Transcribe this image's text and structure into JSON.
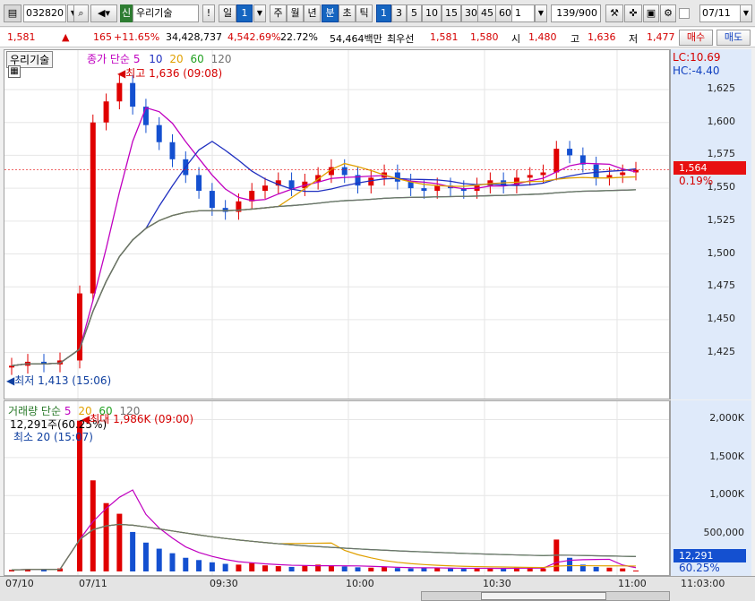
{
  "toolbar": {
    "code": "032820",
    "market_badge": "신",
    "stock_name": "우리기술",
    "alert": "!",
    "period_day": "일",
    "period_day_count": "1",
    "periods": [
      "주",
      "월",
      "년"
    ],
    "minute": "분",
    "second": "초",
    "tick": "틱",
    "intervals": [
      "1",
      "3",
      "5",
      "10",
      "15",
      "30",
      "45",
      "60"
    ],
    "interval_count": "1",
    "data_count": "139/900",
    "date": "07/11"
  },
  "quote": {
    "price": "1,581",
    "change_arrow": "▲",
    "change": "165",
    "change_pct": "+11.65%",
    "volume": "34,428,737",
    "volume_ratio": "4,542.69%",
    "turnover": "22.72%",
    "amount": "54,464백만",
    "best_label": "최우선",
    "ask": "1,581",
    "bid": "1,580",
    "open_label": "시",
    "open": "1,480",
    "high_label": "고",
    "high": "1,636",
    "low_label": "저",
    "low": "1,477",
    "buy_button": "매수",
    "sell_button": "매도"
  },
  "price_panel": {
    "name": "우리기술",
    "legend_label": "종가 단순",
    "ma": [
      "5",
      "10",
      "20",
      "60",
      "120"
    ],
    "ma_colors": [
      "#c000c0",
      "#2030c0",
      "#e0a000",
      "#20a020",
      "#707070"
    ],
    "high_annotation": "최고 1,636 (09:08)",
    "low_annotation": "최저 1,413 (15:06)",
    "lc": "LC:10.69",
    "hc": "HC:-4.40",
    "current_price": "1,564",
    "current_pct": "0.19%",
    "y_ticks": [
      "1,625",
      "1,600",
      "1,575",
      "1,550",
      "1,525",
      "1,500",
      "1,475",
      "1,450",
      "1,425"
    ]
  },
  "volume_panel": {
    "legend_label": "거래량 단순",
    "ma": [
      "5",
      "20",
      "60",
      "120"
    ],
    "ma_colors": [
      "#c000c0",
      "#e0a000",
      "#20a020",
      "#707070"
    ],
    "current_line": "12,291주(60.25%)",
    "max_annotation": "최대 1,986K (09:00)",
    "min_annotation": "최소 20 (15:07)",
    "current_value": "12,291",
    "current_pct": "60.25%",
    "y_ticks": [
      "2,000K",
      "1,500K",
      "1,000K",
      "500,000"
    ]
  },
  "x_axis": {
    "labels": [
      "07/10",
      "07/11",
      "09:30",
      "10:00",
      "10:30",
      "11:00"
    ],
    "time_readout": "11:03:00"
  },
  "colors": {
    "up": "#e00000",
    "down": "#1450d0",
    "accent": "#1565c0"
  },
  "chart_data": {
    "type": "candlestick",
    "title": "우리기술",
    "ylim": [
      1400,
      1640
    ],
    "x": [
      "07/10",
      "07/11 09:00",
      "09:30",
      "10:00",
      "10:30",
      "11:00"
    ],
    "price_close": [
      1415,
      1418,
      1416,
      1419,
      1470,
      1600,
      1616,
      1630,
      1612,
      1598,
      1585,
      1572,
      1560,
      1548,
      1535,
      1532,
      1540,
      1548,
      1552,
      1556,
      1550,
      1555,
      1560,
      1566,
      1560,
      1552,
      1558,
      1562,
      1555,
      1550,
      1548,
      1552,
      1550,
      1548,
      1552,
      1556,
      1552,
      1558,
      1560,
      1562,
      1580,
      1575,
      1568,
      1558,
      1560,
      1562,
      1564
    ],
    "volume_k": [
      20,
      30,
      25,
      40,
      1986,
      1200,
      900,
      760,
      520,
      380,
      300,
      240,
      180,
      150,
      120,
      100,
      90,
      110,
      80,
      70,
      60,
      75,
      90,
      80,
      65,
      55,
      50,
      60,
      45,
      40,
      50,
      45,
      40,
      35,
      40,
      45,
      40,
      50,
      45,
      40,
      420,
      180,
      90,
      60,
      50,
      40,
      12
    ]
  }
}
